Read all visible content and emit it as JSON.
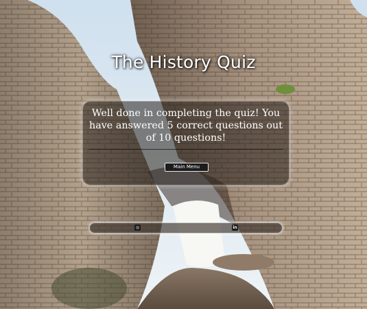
{
  "header": {
    "title": "The History Quiz"
  },
  "result": {
    "message": "Well done in completing the quiz! You have answered 5 correct questions out of 10 questions!",
    "correct": 5,
    "total": 10,
    "button_label": "Main Menu"
  },
  "footer": {
    "links": [
      {
        "icon": "github-icon"
      },
      {
        "icon": "linkedin-icon"
      }
    ]
  }
}
